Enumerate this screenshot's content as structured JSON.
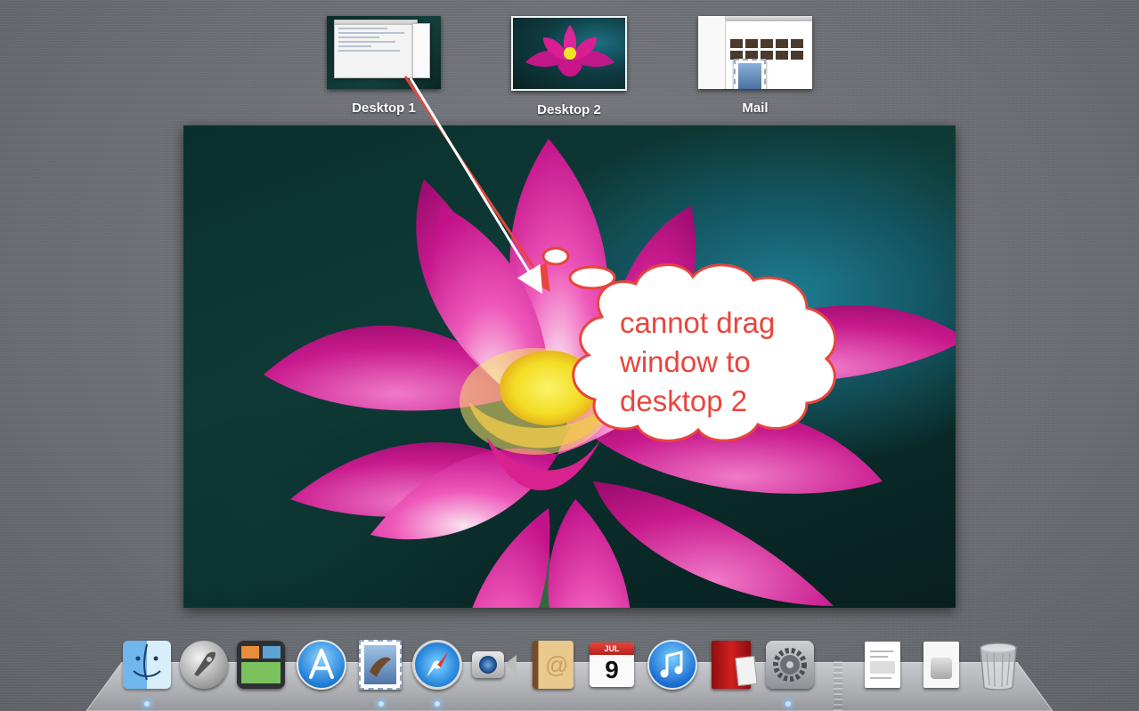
{
  "spaces": [
    {
      "label": "Desktop 1"
    },
    {
      "label": "Desktop 2"
    },
    {
      "label": "Mail"
    }
  ],
  "annotation": {
    "line1": "cannot drag",
    "line2": "window to",
    "line3": "desktop 2",
    "color": "#e8453c"
  },
  "calendar": {
    "month": "JUL",
    "day": "9"
  },
  "dock": {
    "apps": [
      "finder-icon",
      "launchpad-icon",
      "mission-control-icon",
      "app-store-icon",
      "mail-icon",
      "safari-icon",
      "facetime-icon",
      "address-book-icon",
      "ical-icon",
      "itunes-icon",
      "photo-booth-icon",
      "system-preferences-icon"
    ],
    "documents": [
      "document-icon",
      "downloads-icon",
      "trash-icon"
    ]
  }
}
